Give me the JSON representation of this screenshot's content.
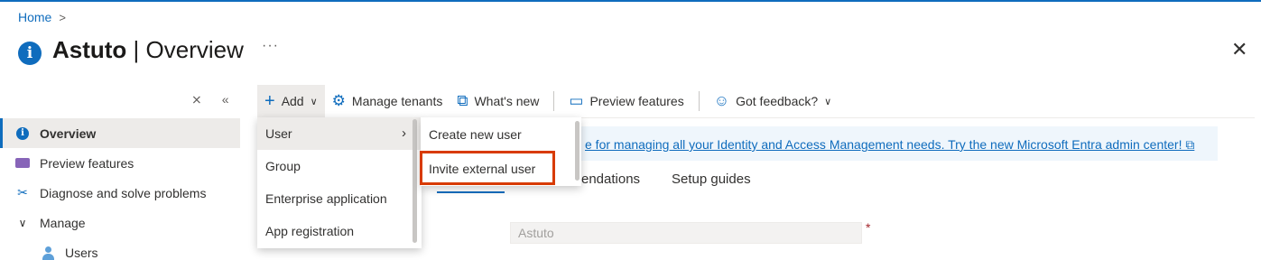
{
  "breadcrumb": {
    "home": "Home",
    "chevron": ">"
  },
  "page": {
    "title_bold": "Astuto",
    "title_rest": " | Overview",
    "more": "···",
    "close": "✕"
  },
  "sidebar": {
    "collapse_x": "⨯",
    "collapse_arrows": "«",
    "items": [
      {
        "label": "Overview",
        "icon": "info-icon"
      },
      {
        "label": "Preview features",
        "icon": "preview-icon"
      },
      {
        "label": "Diagnose and solve problems",
        "icon": "wrench-icon"
      },
      {
        "label": "Manage",
        "icon": "chevron-down-icon"
      },
      {
        "label": "Users",
        "icon": "user-icon"
      }
    ]
  },
  "toolbar": {
    "add": "Add",
    "manage_tenants": "Manage tenants",
    "whats_new": "What's new",
    "preview_features": "Preview features",
    "got_feedback": "Got feedback?"
  },
  "banner": {
    "text": "e for managing all your Identity and Access Management needs. Try the new Microsoft Entra admin center! ⧉"
  },
  "tabs": {
    "recommendations": "endations",
    "setup_guides": "Setup guides"
  },
  "form": {
    "name_value": "Astuto",
    "required": "*"
  },
  "add_menu": {
    "items": [
      "User",
      "Group",
      "Enterprise application",
      "App registration"
    ]
  },
  "user_submenu": {
    "items": [
      "Create new user",
      "Invite external user"
    ]
  },
  "colors": {
    "accent": "#0f6cbd",
    "highlight_box": "#d83b01"
  }
}
